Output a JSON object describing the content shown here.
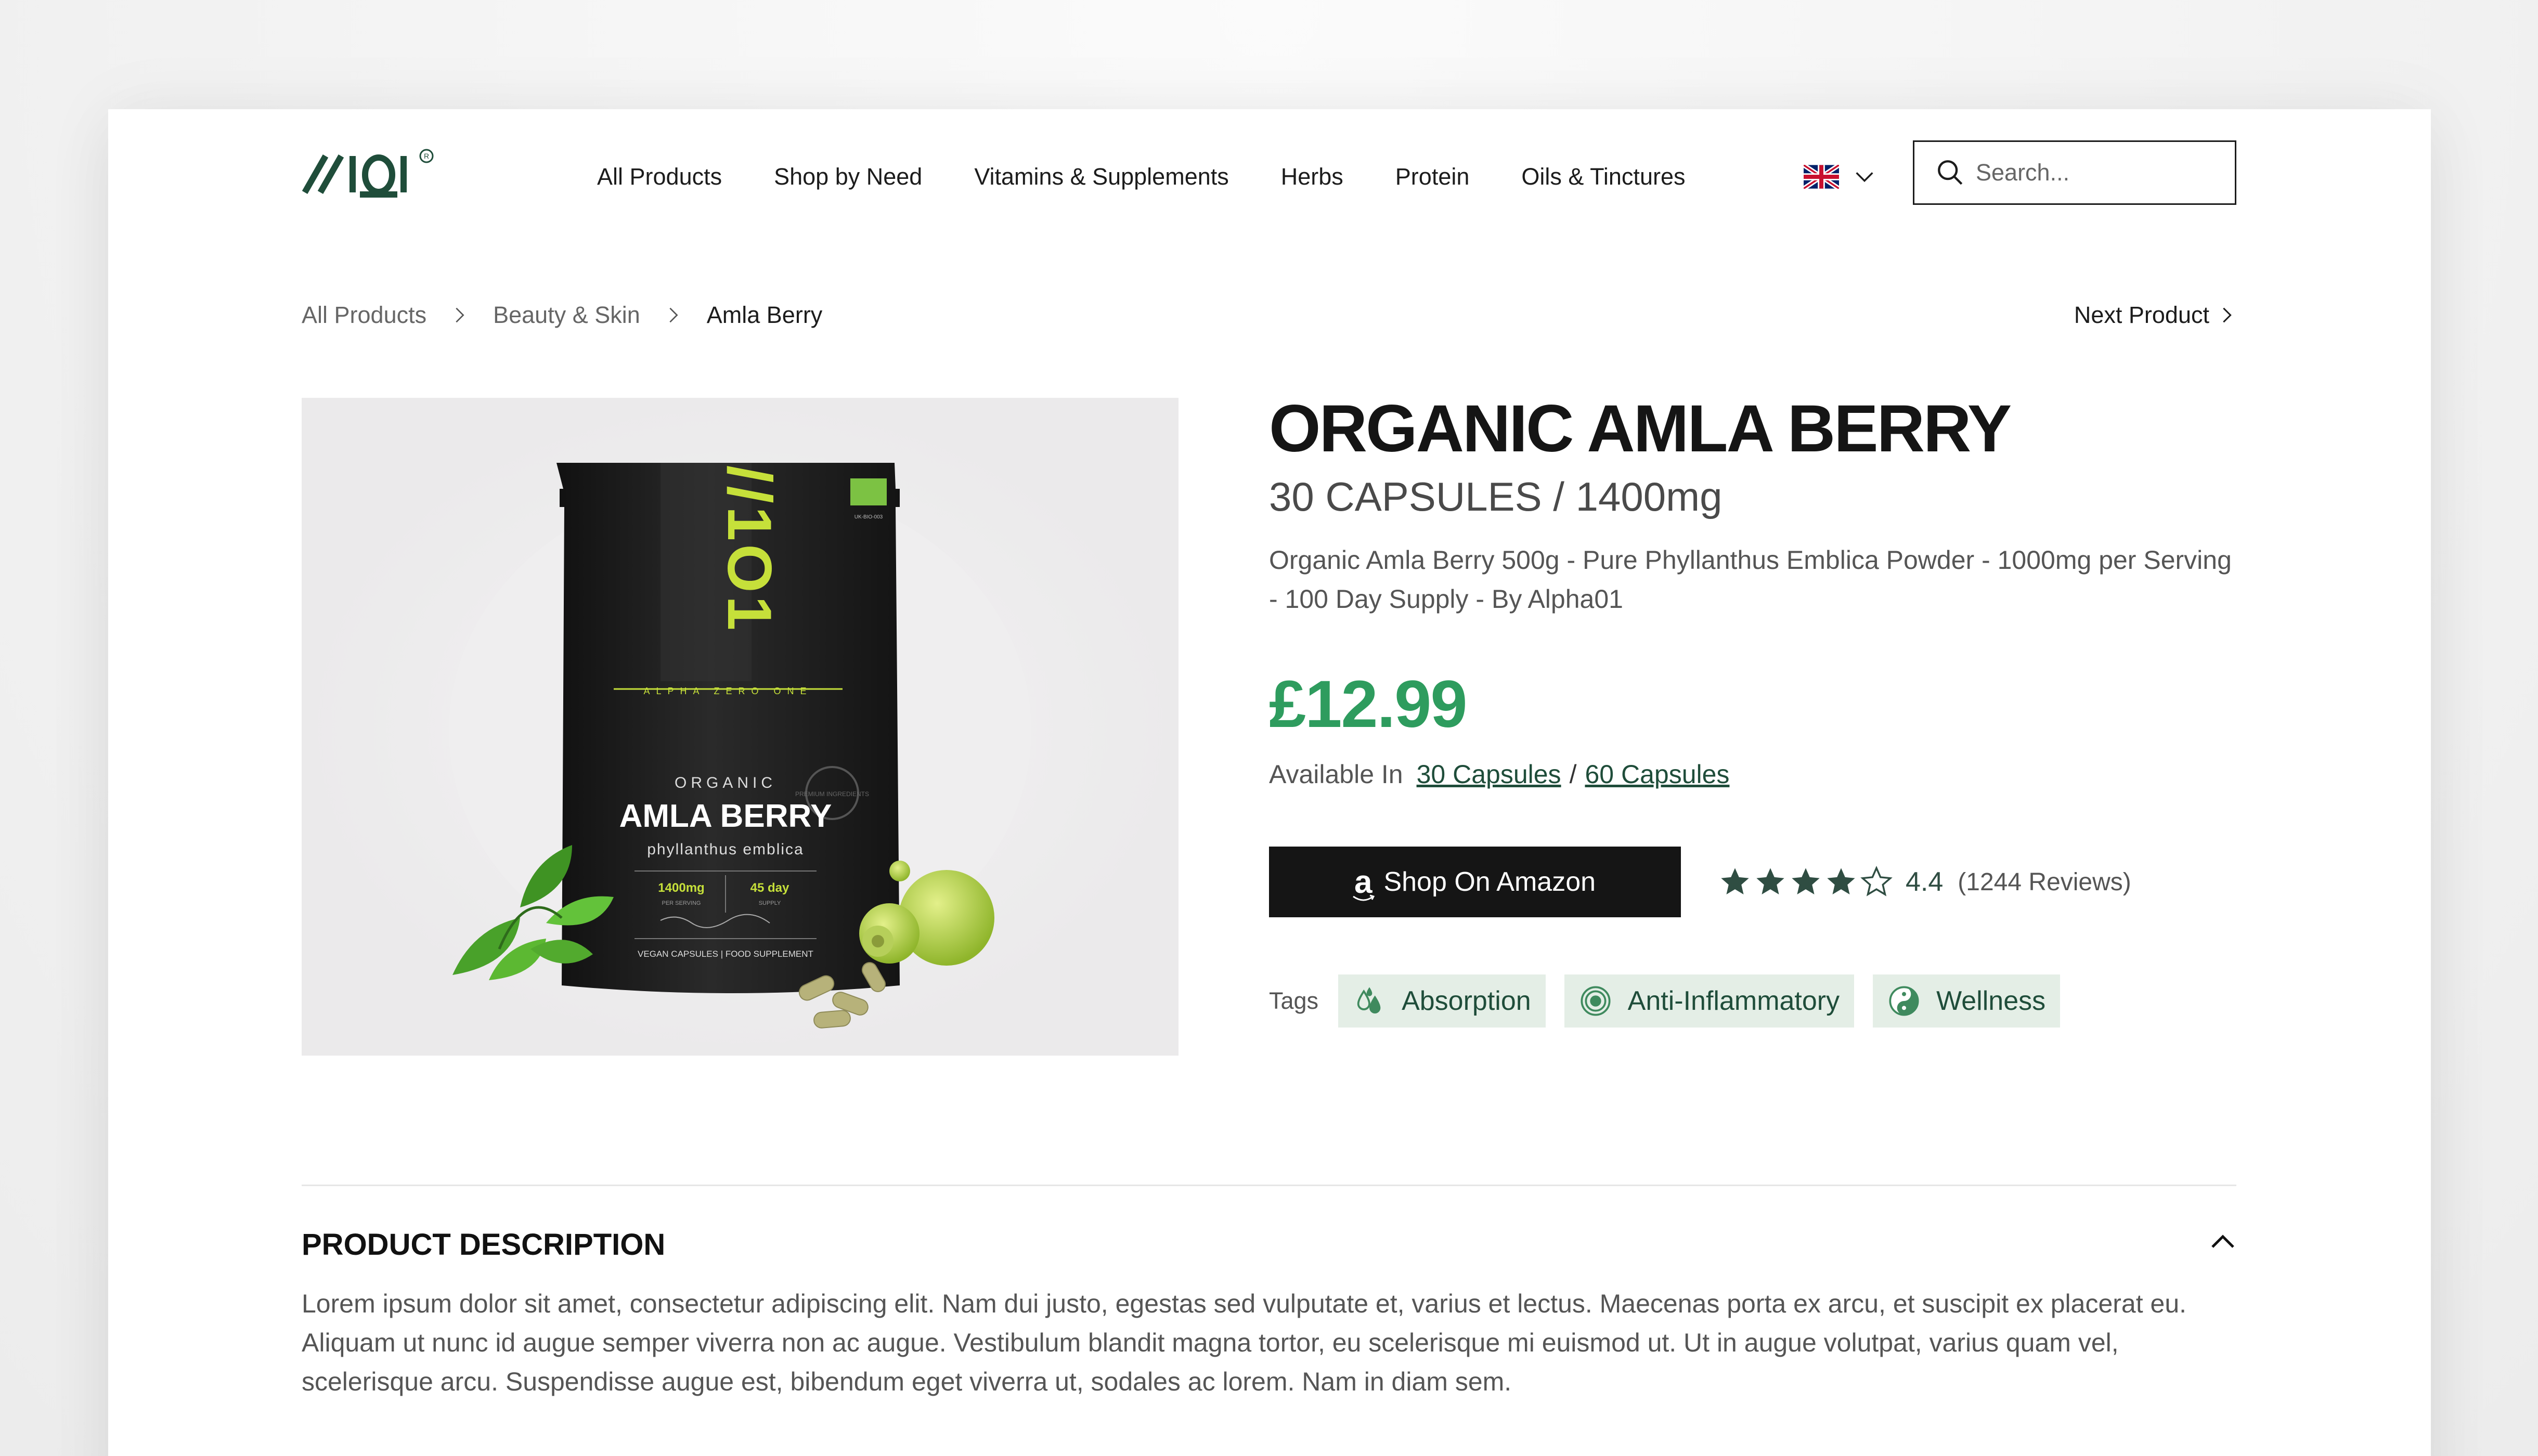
{
  "header": {
    "logo_text": "//101",
    "nav": [
      "All Products",
      "Shop by Need",
      "Vitamins & Supplements",
      "Herbs",
      "Protein",
      "Oils & Tinctures"
    ],
    "language_icon": "uk-flag-icon",
    "search": {
      "placeholder": "Search..."
    }
  },
  "breadcrumb": [
    "All Products",
    "Beauty & Skin",
    "Amla Berry"
  ],
  "next_product_label": "Next Product",
  "product": {
    "image_text": {
      "brand": "ALPHA ZERO ONE",
      "organic": "ORGANIC",
      "name": "AMLA BERRY",
      "latin": "phyllanthus emblica",
      "stat1_value": "1400mg",
      "stat1_label": "PER SERVING",
      "stat2_value": "45 day",
      "stat2_label": "SUPPLY",
      "footer": "VEGAN CAPSULES | FOOD SUPPLEMENT",
      "seal": "PREMIUM INGREDIENTS"
    },
    "title": "ORGANIC AMLA BERRY",
    "subtitle": "30 CAPSULES / 1400mg",
    "description": "Organic Amla Berry 500g - Pure Phyllanthus Emblica Powder - 1000mg per Serving - 100 Day Supply - By Alpha01",
    "price": "£12.99",
    "available_label": "Available In",
    "variants": [
      "30 Capsules",
      "60 Capsules"
    ],
    "variant_separator": "/",
    "buy_button": "Shop On Amazon",
    "amazon_logo_glyph": "a",
    "rating": {
      "value": "4.4",
      "count_label": "(1244 Reviews)",
      "stars_filled": 4,
      "stars_total": 5
    },
    "tags_label": "Tags",
    "tags": [
      {
        "label": "Absorption",
        "icon": "water-drops-icon"
      },
      {
        "label": "Anti-Inflammatory",
        "icon": "target-rings-icon"
      },
      {
        "label": "Wellness",
        "icon": "yin-yang-icon"
      }
    ]
  },
  "description_section": {
    "title": "PRODUCT DESCRIPTION",
    "body": "Lorem ipsum dolor sit amet, consectetur adipiscing elit. Nam dui justo, egestas sed vulputate et, varius et lectus. Maecenas porta ex arcu, et suscipit ex placerat eu. Aliquam ut nunc id augue semper viverra non ac augue. Vestibulum blandit magna tortor, eu scelerisque mi euismod ut. Ut in augue volutpat, varius quam vel, scelerisque arcu. Suspendisse augue est, bibendum eget viverra ut, sodales ac lorem. Nam in diam sem."
  },
  "colors": {
    "accent_green": "#2e9c5e",
    "dark_green": "#1f4d3a",
    "tag_bg": "#e4eee6",
    "button_bg": "#151515",
    "lime": "#c6e03a"
  }
}
